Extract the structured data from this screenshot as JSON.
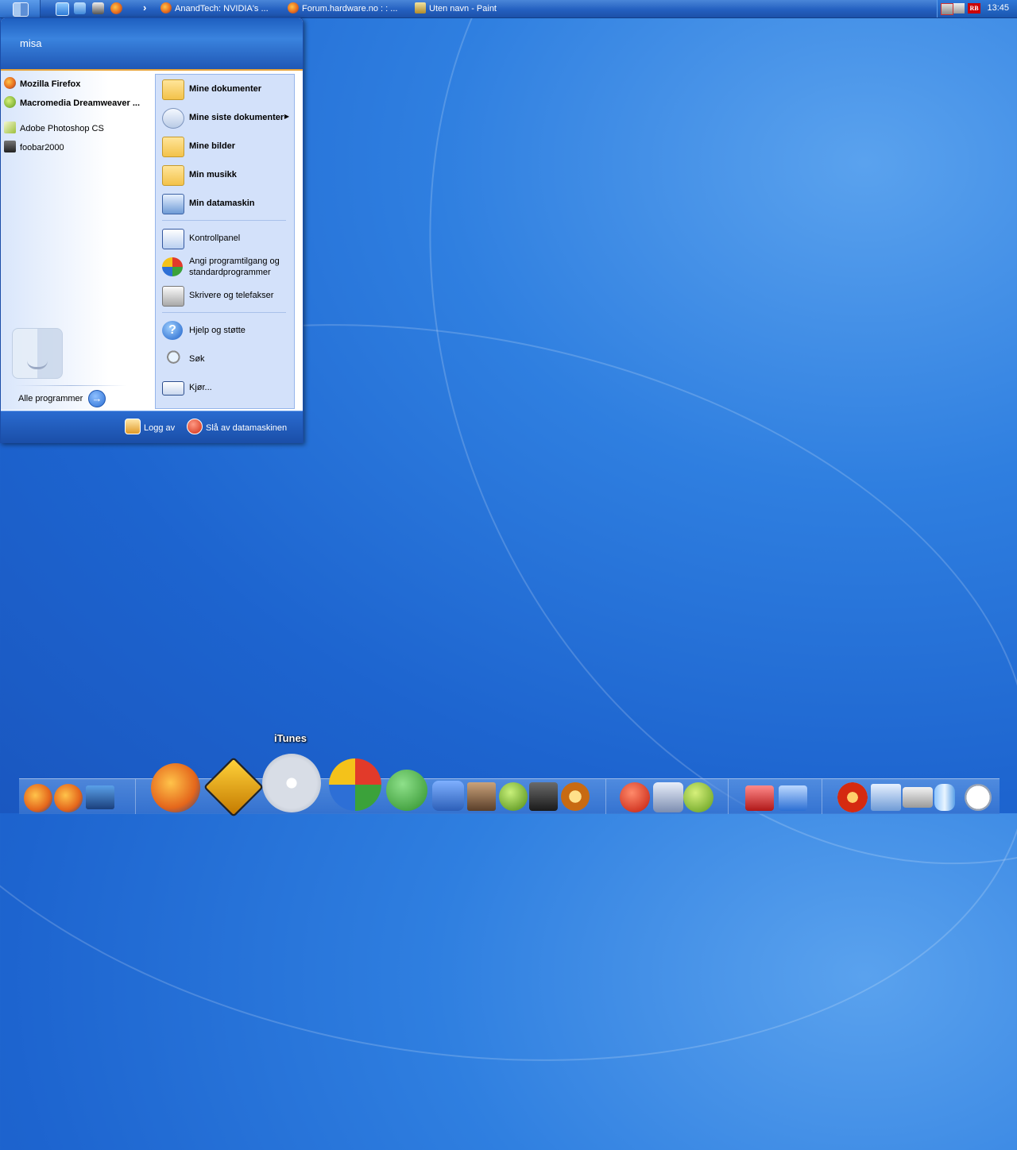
{
  "taskbar": {
    "tasks": [
      {
        "label": "AnandTech: NVIDIA's ..."
      },
      {
        "label": "Forum.hardware.no : : ..."
      },
      {
        "label": "Uten navn - Paint"
      }
    ],
    "overflow_label": "›",
    "tray": {
      "badge": "RB",
      "clock": "13:45"
    }
  },
  "start_menu": {
    "user_name": "misa",
    "pinned": [
      {
        "label": "Mozilla Firefox",
        "icon": "firefox-icon"
      },
      {
        "label": "Macromedia Dreamweaver ...",
        "icon": "dreamweaver-icon"
      }
    ],
    "recent": [
      {
        "label": "Adobe Photoshop CS",
        "icon": "photoshop-icon"
      },
      {
        "label": "foobar2000",
        "icon": "foobar-icon"
      }
    ],
    "all_programs_label": "Alle programmer",
    "places": [
      {
        "label": "Mine dokumenter",
        "icon": "folder-documents-icon"
      },
      {
        "label": "Mine siste dokumenter",
        "icon": "recent-documents-icon",
        "submenu": true
      },
      {
        "label": "Mine bilder",
        "icon": "folder-pictures-icon"
      },
      {
        "label": "Min musikk",
        "icon": "folder-music-icon"
      },
      {
        "label": "Min datamaskin",
        "icon": "computer-icon"
      }
    ],
    "system": [
      {
        "label": "Kontrollpanel",
        "icon": "control-panel-icon"
      },
      {
        "label": "Angi programtilgang og standardprogrammer",
        "icon": "set-program-access-icon"
      },
      {
        "label": "Skrivere og telefakser",
        "icon": "printer-icon"
      }
    ],
    "help": [
      {
        "label": "Hjelp og støtte",
        "icon": "help-icon"
      },
      {
        "label": "Søk",
        "icon": "search-icon"
      },
      {
        "label": "Kjør...",
        "icon": "run-icon"
      }
    ],
    "footer": {
      "logoff_label": "Logg av",
      "shutdown_label": "Slå av datamaskinen"
    }
  },
  "dock": {
    "hover_label": "iTunes"
  },
  "colors": {
    "desktop": "#2f7fe0",
    "taskbar": "#2460c0",
    "places_panel": "#d3e1fa",
    "accent_line": "#e8a43a"
  }
}
